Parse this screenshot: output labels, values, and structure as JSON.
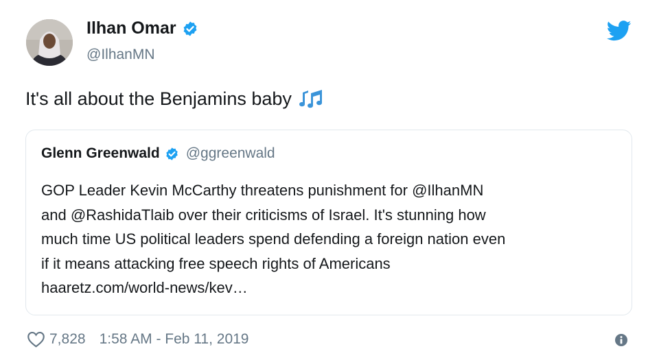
{
  "author": {
    "name": "Ilhan Omar",
    "handle": "@IlhanMN",
    "avatar_icon": "profile-photo",
    "verified_icon": "verified-badge-icon"
  },
  "tweet": {
    "text": "It's all about the Benjamins baby",
    "emoji_icon": "musical-notes-icon"
  },
  "quoted": {
    "name": "Glenn Greenwald",
    "handle": "@ggreenwald",
    "lines": [
      "GOP Leader Kevin McCarthy threatens punishment for @IlhanMN",
      "and @RashidaTlaib over their criticisms of Israel. It's stunning how",
      "much time US political leaders spend defending a foreign nation even",
      "if it means attacking free speech rights of Americans",
      "haaretz.com/world-news/kev…"
    ]
  },
  "footer": {
    "likes": "7,828",
    "timestamp": "1:58 AM - Feb 11, 2019"
  },
  "colors": {
    "brand_blue": "#1da1f2",
    "secondary_text": "#657786",
    "primary_text": "#14171a",
    "border": "#e1e8ed"
  }
}
